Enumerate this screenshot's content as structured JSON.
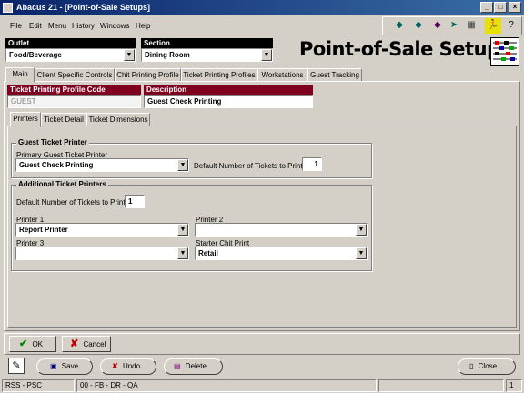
{
  "window": {
    "title": "Abacus 21 - [Point-of-Sale Setups]"
  },
  "menu": [
    "File",
    "Edit",
    "Menu",
    "History",
    "Windows",
    "Help"
  ],
  "toolbar_icons": [
    "arrow-left-icon",
    "arrow-right-icon",
    "gem-icon",
    "arrow-right2-icon",
    "calculator-icon",
    "runner-icon",
    "help-icon"
  ],
  "header": {
    "outlet_label": "Outlet",
    "outlet_value": "Food/Beverage",
    "section_label": "Section",
    "section_value": "Dining Room",
    "page_title": "Point-of-Sale Setups"
  },
  "main_tabs": [
    "Main",
    "Client Specific Controls",
    "Chit Printing Profile",
    "Ticket Printing Profiles",
    "Workstations",
    "Guest Tracking"
  ],
  "profile": {
    "code_label": "Ticket Printing Profile Code",
    "code_value": "GUEST",
    "desc_label": "Description",
    "desc_value": "Guest Check Printing"
  },
  "sub_tabs": [
    "Printers",
    "Ticket Detail",
    "Ticket Dimensions"
  ],
  "guest_printer": {
    "group_title": "Guest Ticket Printer",
    "primary_label": "Primary Guest Ticket Printer",
    "primary_value": "Guest Check Printing",
    "default_label": "Default Number of Tickets to Print",
    "default_value": "1"
  },
  "additional": {
    "group_title": "Additional Ticket Printers",
    "default_label": "Default Number of Tickets to Print",
    "default_value": "1",
    "printer1_label": "Printer 1",
    "printer1_value": "Report Printer",
    "printer2_label": "Printer 2",
    "printer2_value": "",
    "printer3_label": "Printer 3",
    "printer3_value": "",
    "starter_label": "Starter Chit Print",
    "starter_value": "Retail"
  },
  "dialog_buttons": {
    "ok": "OK",
    "cancel": "Cancel"
  },
  "bottom_buttons": {
    "save": "Save",
    "undo": "Undo",
    "delete": "Delete",
    "close": "Close"
  },
  "status": {
    "left": "RSS - PSC",
    "mid": "00 - FB - DR - QA",
    "right": "1"
  }
}
